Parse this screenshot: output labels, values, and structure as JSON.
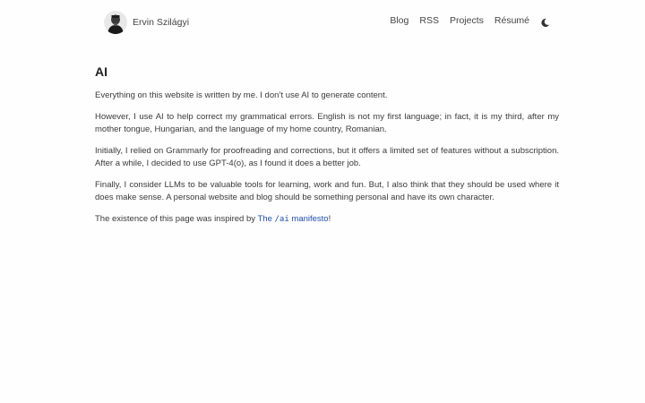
{
  "header": {
    "name": "Ervin Szilágyi",
    "nav": [
      "Blog",
      "RSS",
      "Projects",
      "Résumé"
    ],
    "theme_icon": "moon-icon"
  },
  "main": {
    "title": "AI",
    "paragraphs": [
      "Everything on this website is written by me. I don’t use AI to generate content.",
      "However, I use AI to help correct my grammatical errors. English is not my first language; in fact, it is my third, after my mother tongue, Hungarian, and the language of my home country, Romanian.",
      "Initially, I relied on Grammarly for proofreading and corrections, but it offers a limited set of features without a subscription. After a while, I decided to use GPT-4(o), as I found it does a better job.",
      "Finally, I consider LLMs to be valuable tools for learning, work and fun. But, I also think that they should be used where it does make sense. A personal website and blog should be something personal and have its own character."
    ],
    "inspired": {
      "prefix": "The existence of this page was inspired by ",
      "link_pre": "The ",
      "link_code": "/ai",
      "link_post": " manifesto",
      "suffix": "!"
    }
  },
  "colors": {
    "link": "#1f4fa8",
    "text": "#3a3a3a",
    "background": "#fefefe"
  }
}
